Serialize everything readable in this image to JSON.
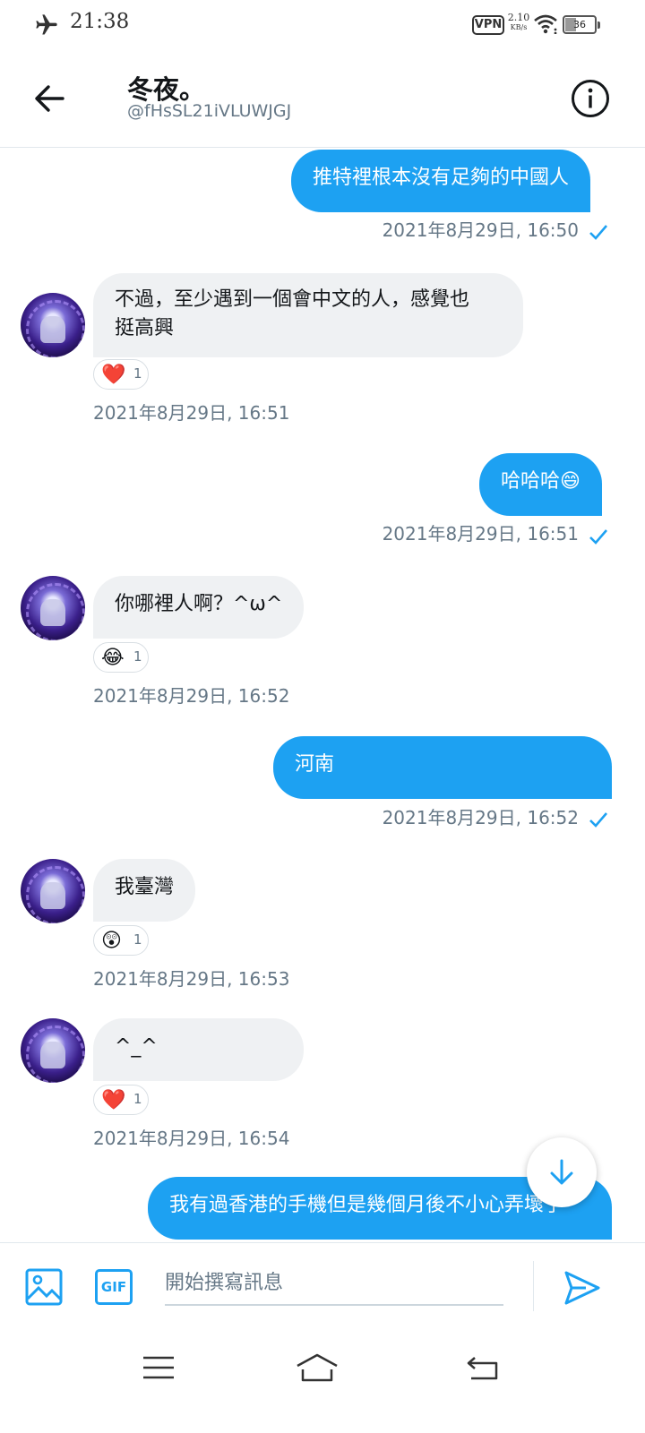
{
  "status_bar": {
    "time": "21:38",
    "vpn_label": "VPN",
    "speed_value": "2.10",
    "speed_unit": "KB/s",
    "battery_level": "36"
  },
  "header": {
    "name": "冬夜。",
    "handle": "@fHsSL21iVLUWJGJ"
  },
  "messages": [
    {
      "direction": "sent",
      "text": "推特裡根本沒有足夠的中國人",
      "timestamp": "2021年8月29日, 16:50",
      "read": true
    },
    {
      "direction": "received",
      "text_line1": "不過，至少遇到一個會中文的人，感覺也",
      "text_line2": "挺高興",
      "reaction": {
        "emoji": "❤️",
        "count": "1"
      },
      "timestamp": "2021年8月29日, 16:51"
    },
    {
      "direction": "sent",
      "text": "哈哈哈😄",
      "timestamp": "2021年8月29日, 16:51",
      "read": true
    },
    {
      "direction": "received",
      "text": "你哪裡人啊？^ω^",
      "reaction": {
        "emoji": "😂",
        "count": "1"
      },
      "timestamp": "2021年8月29日, 16:52"
    },
    {
      "direction": "sent",
      "text": "河南",
      "timestamp": "2021年8月29日, 16:52",
      "read": true
    },
    {
      "direction": "received",
      "text": "我臺灣",
      "reaction": {
        "emoji": "😲",
        "count": "1"
      },
      "timestamp": "2021年8月29日, 16:53"
    },
    {
      "direction": "received",
      "text": "^_^",
      "reaction": {
        "emoji": "❤️",
        "count": "1"
      },
      "timestamp": "2021年8月29日, 16:54"
    },
    {
      "direction": "sent",
      "text": "我有過香港的手機但是幾個月後不小心弄壞了"
    }
  ],
  "composer": {
    "gif_label": "GIF",
    "placeholder": "開始撰寫訊息"
  },
  "colors": {
    "accent": "#1da1f2",
    "received_bubble": "#eff1f3",
    "muted_text": "#657786"
  }
}
